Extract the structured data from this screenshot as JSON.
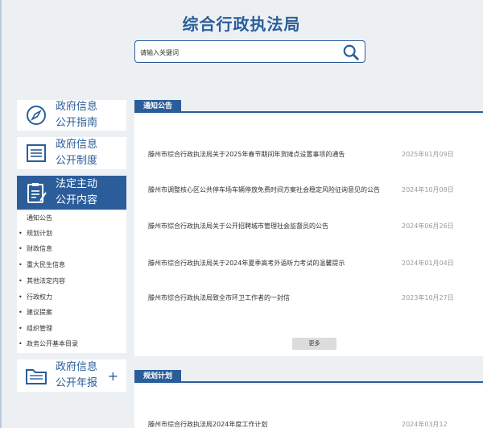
{
  "header": {
    "site_title": "综合行政执法局",
    "search_placeholder": "请输入关键词"
  },
  "sidebar": {
    "cards": [
      {
        "line1": "政府信息",
        "line2": "公开指南",
        "icon": "compass-icon",
        "active": false
      },
      {
        "line1": "政府信息",
        "line2": "公开制度",
        "icon": "document-list-icon",
        "active": false
      },
      {
        "line1": "法定主动",
        "line2": "公开内容",
        "icon": "clipboard-icon",
        "active": true
      },
      {
        "line1": "政府信息",
        "line2": "公开年报",
        "icon": "folder-icon",
        "active": false,
        "expand": "+"
      }
    ],
    "submenu": [
      "通知公告",
      "规划计划",
      "财政信息",
      "重大民生信息",
      "其他法定内容",
      "行政权力",
      "建议提案",
      "组织管理",
      "政务公开基本目录"
    ]
  },
  "notices": {
    "title": "通知公告",
    "items": [
      {
        "title": "滕州市综合行政执法局关于2025年春节期间年货摊点设置事项的通告",
        "date": "2025年01月09日"
      },
      {
        "title": "滕州市调整核心区公共停车场车辆停放免费时间方案社会稳定风险征询意见的公告",
        "date": "2024年10月08日"
      },
      {
        "title": "滕州市综合行政执法局关于公开招聘城市管理社会监督员的公告",
        "date": "2024年06月26日"
      },
      {
        "title": "滕州市综合行政执法局关于2024年夏季高考外语听力考试的温馨提示",
        "date": "2024年01月04日"
      },
      {
        "title": "滕州市综合行政执法局致全市环卫工作者的一封信",
        "date": "2023年10月27日"
      }
    ],
    "more": "更多"
  },
  "plans": {
    "title": "规划计划",
    "items": [
      {
        "title": "滕州市综合行政执法局2024年度工作计划",
        "date": "2024年03月12"
      }
    ]
  },
  "colors": {
    "accent": "#2b5d9a",
    "background": "#edf0f3"
  }
}
